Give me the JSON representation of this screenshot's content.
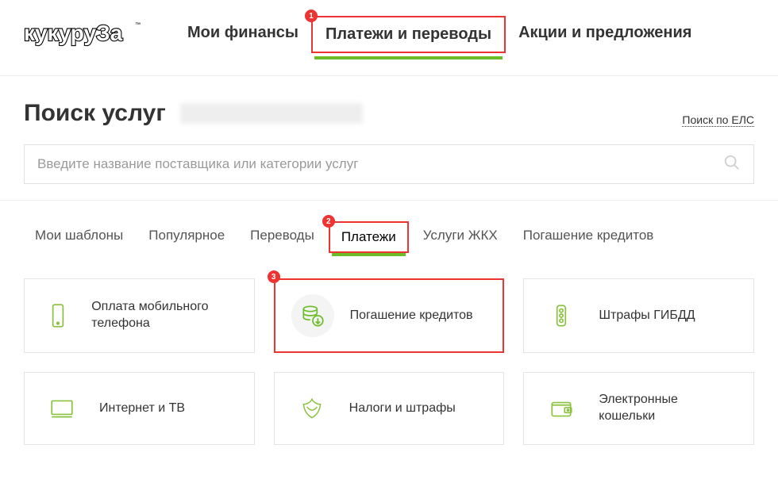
{
  "logo_text": "кукуруЗа",
  "top_nav": {
    "items": [
      {
        "label": "Мои финансы"
      },
      {
        "label": "Платежи и переводы"
      },
      {
        "label": "Акции и предложения"
      }
    ]
  },
  "badges": {
    "b1": "1",
    "b2": "2",
    "b3": "3"
  },
  "search": {
    "title": "Поиск услуг",
    "els_link": "Поиск по ЕЛС",
    "placeholder": "Введите название поставщика или категории услуг"
  },
  "subnav": {
    "items": [
      {
        "label": "Мои шаблоны"
      },
      {
        "label": "Популярное"
      },
      {
        "label": "Переводы"
      },
      {
        "label": "Платежи"
      },
      {
        "label": "Услуги ЖКХ"
      },
      {
        "label": "Погашение кредитов"
      }
    ]
  },
  "tiles": [
    {
      "label": "Оплата мобильного телефона",
      "icon": "phone"
    },
    {
      "label": "Погашение кредитов",
      "icon": "coins"
    },
    {
      "label": "Штрафы ГИБДД",
      "icon": "traffic-light"
    },
    {
      "label": "Интернет и ТВ",
      "icon": "monitor"
    },
    {
      "label": "Налоги и штрафы",
      "icon": "emblem"
    },
    {
      "label": "Электронные кошельки",
      "icon": "wallet"
    }
  ]
}
